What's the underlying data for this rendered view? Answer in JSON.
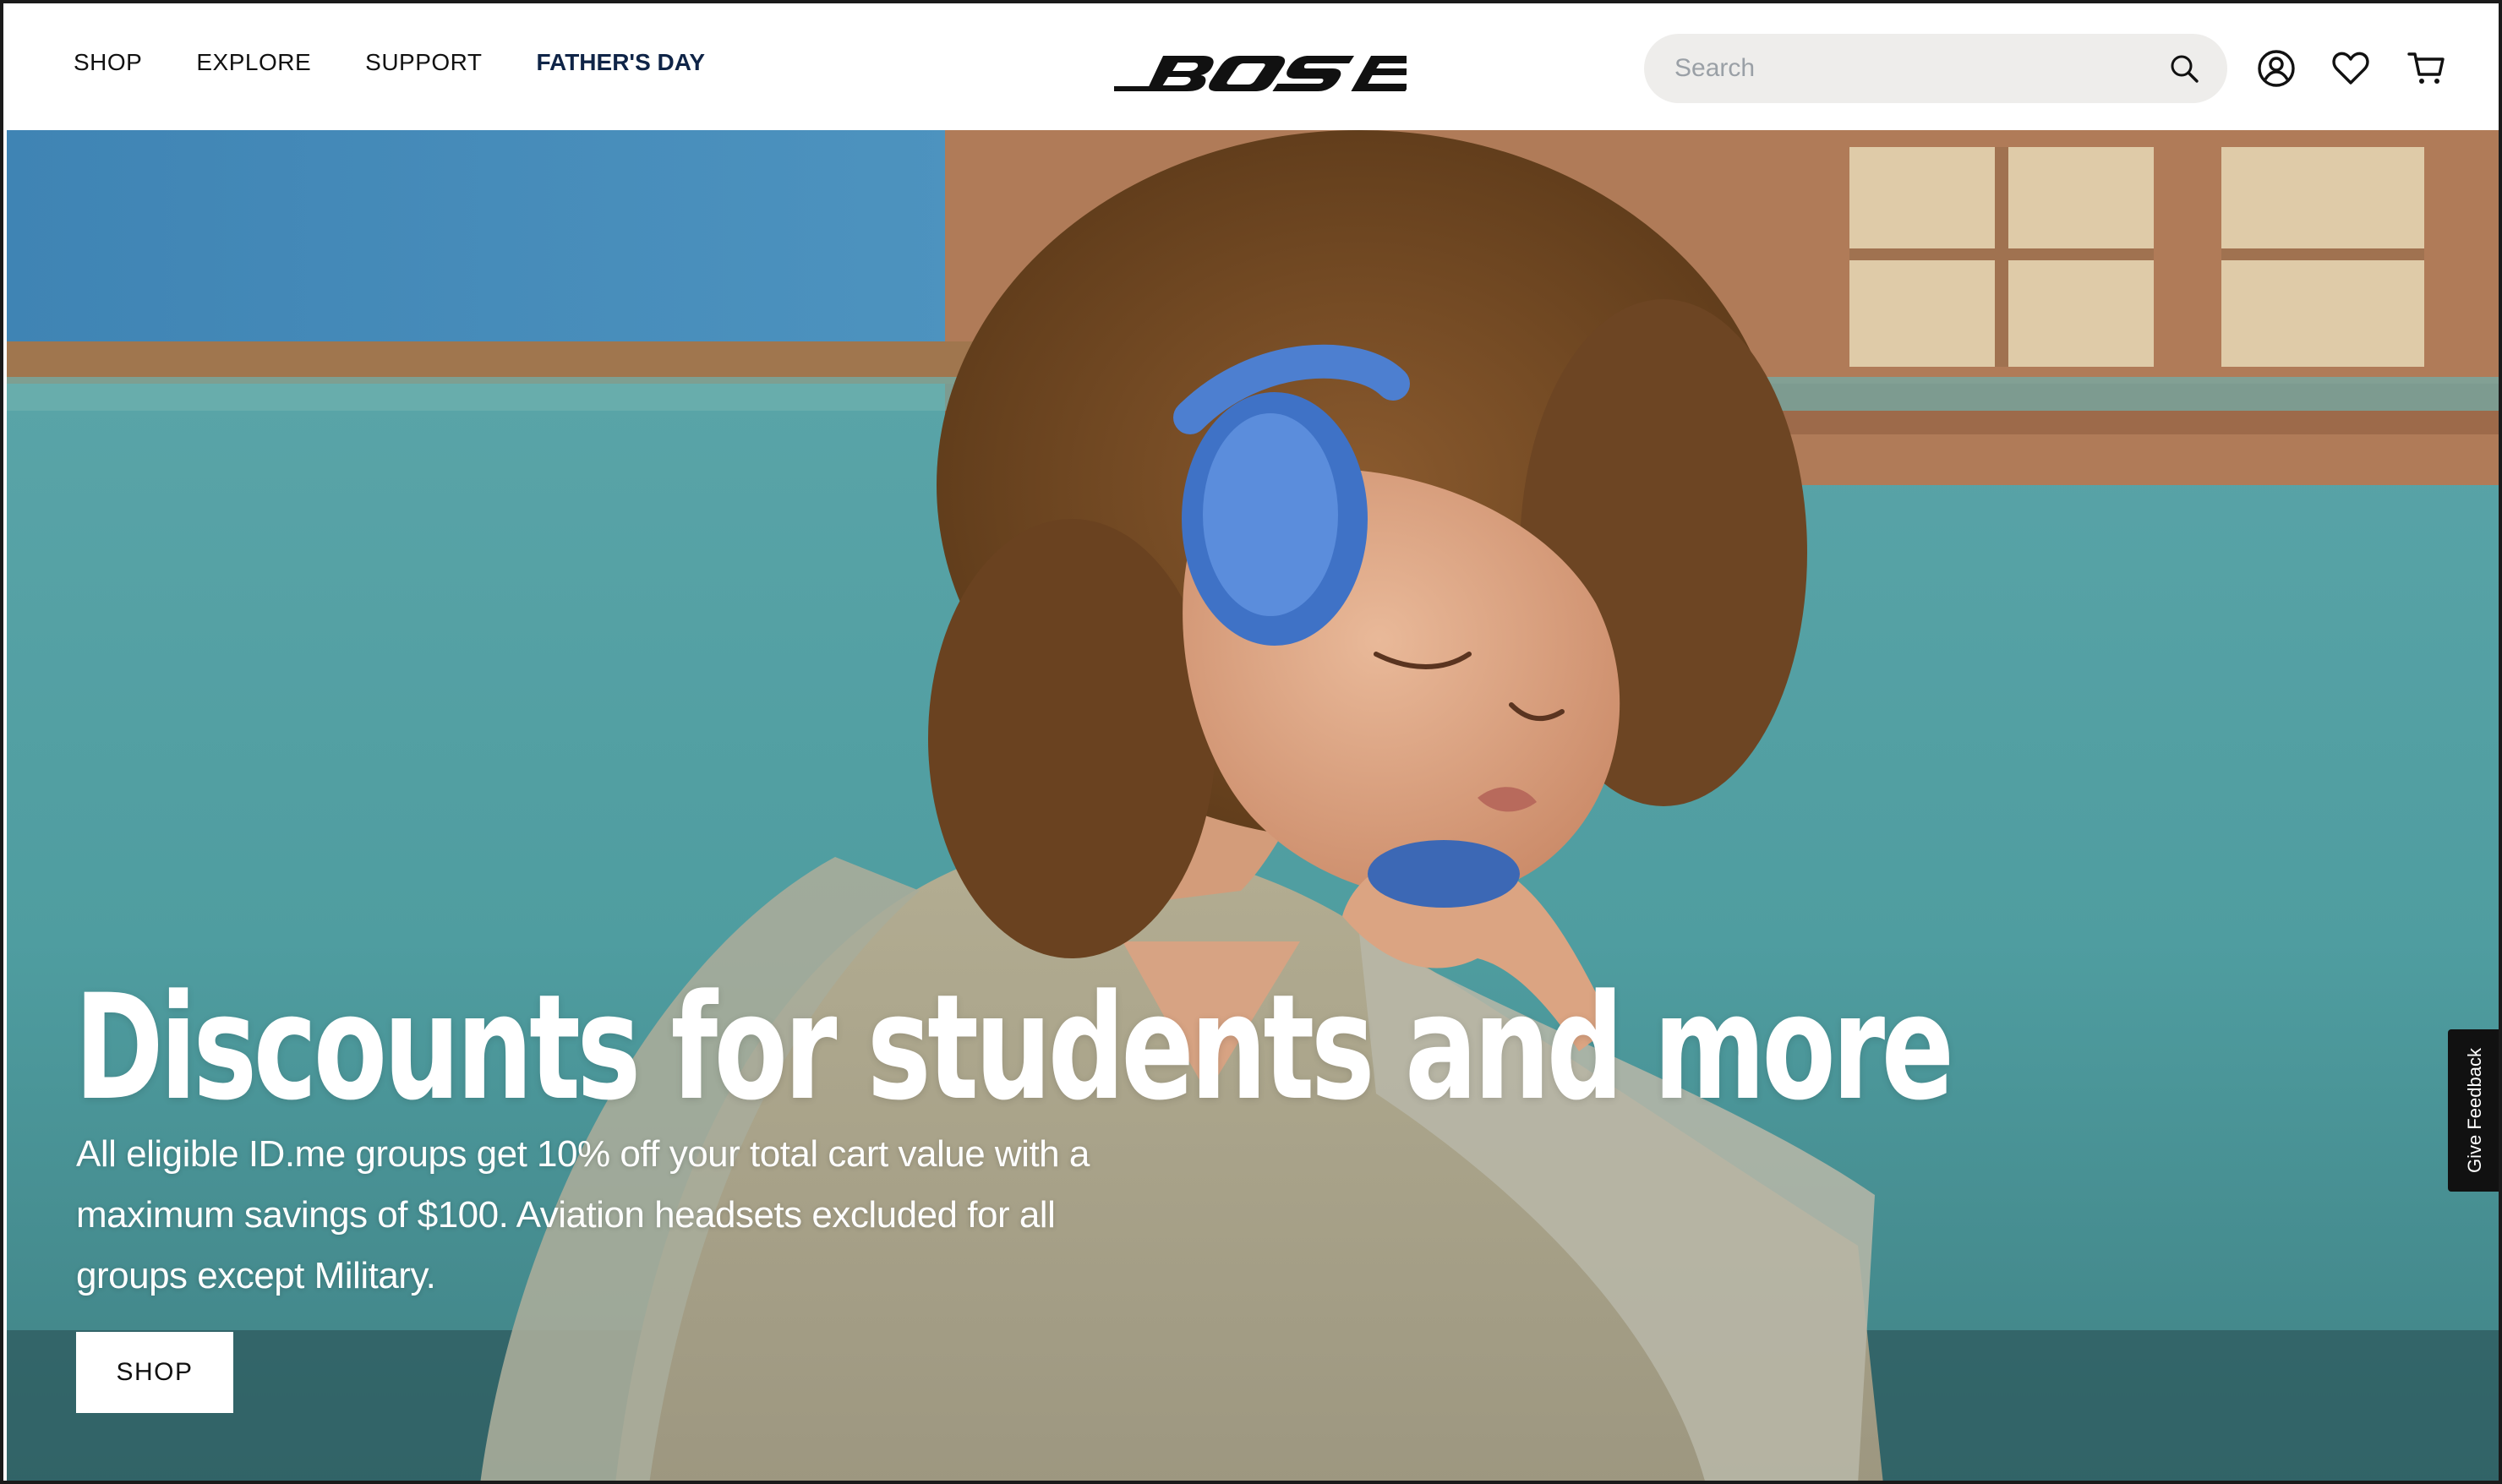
{
  "brand": {
    "name": "BOSE",
    "logo_icon": "bose-wordmark-logo"
  },
  "nav": {
    "items": [
      {
        "label": "SHOP"
      },
      {
        "label": "EXPLORE"
      },
      {
        "label": "SUPPORT"
      },
      {
        "label": "FATHER'S DAY",
        "highlight": true
      }
    ]
  },
  "search": {
    "placeholder": "Search",
    "icon": "search-icon"
  },
  "header_icons": {
    "account": "account-icon",
    "wishlist": "heart-icon",
    "cart": "cart-icon"
  },
  "hero": {
    "image": "woman-wearing-blue-headphones-photo",
    "headline": "Discounts for students and more",
    "body": "All eligible ID.me groups get 10% off your total cart value with a maximum savings of $100. Aviation headsets excluded for all groups except Military.",
    "cta_label": "SHOP"
  },
  "feedback_tab": {
    "label": "Give Feedback"
  },
  "colors": {
    "promo_nav": "#0f2447",
    "search_bg": "#eeedeb",
    "feedback_bg": "#111111",
    "hero_wall": "#5aa3a6",
    "headphone_blue": "#4d7fd0"
  }
}
